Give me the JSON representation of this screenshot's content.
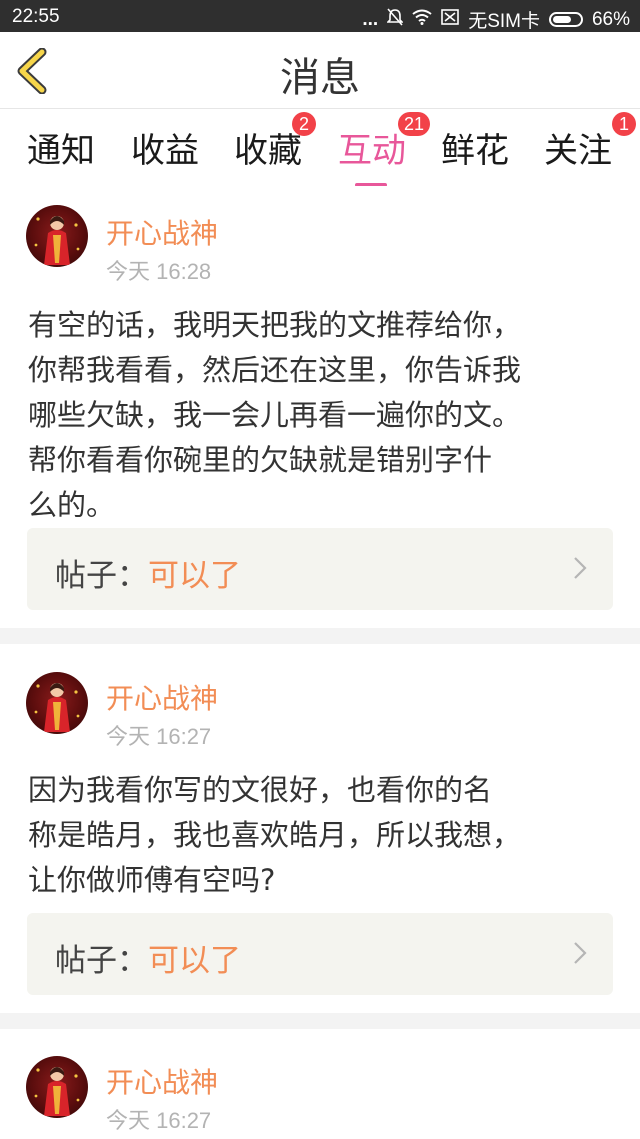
{
  "status_bar": {
    "time": "22:55",
    "dots": "...",
    "sim": "无SIM卡",
    "battery": "66%"
  },
  "header": {
    "title": "消息"
  },
  "tabs": [
    {
      "label": "通知",
      "badge": ""
    },
    {
      "label": "收益",
      "badge": ""
    },
    {
      "label": "收藏",
      "badge": "2"
    },
    {
      "label": "互动",
      "badge": "21",
      "active": true
    },
    {
      "label": "鲜花",
      "badge": ""
    },
    {
      "label": "关注",
      "badge": "1"
    }
  ],
  "colors": {
    "accent": "#e8579a",
    "name": "#f28d55",
    "badge": "#f24148"
  },
  "messages": [
    {
      "user": "开心战神",
      "time": "今天 16:28",
      "lines": [
        "有空的话，我明天把我的文推荐给你，",
        "你帮我看看，然后还在这里，你告诉我",
        "哪些欠缺，我一会儿再看一遍你的文。",
        "帮你看看你碗里的欠缺就是错别字什",
        "么的。"
      ],
      "post_label": "帖子：",
      "post_title": "可以了"
    },
    {
      "user": "开心战神",
      "time": "今天 16:27",
      "lines": [
        "因为我看你写的文很好，也看你的名",
        "称是皓月，我也喜欢皓月，所以我想，",
        "让你做师傅有空吗?"
      ],
      "post_label": "帖子：",
      "post_title": "可以了"
    },
    {
      "user": "开心战神",
      "time": "今天 16:27"
    }
  ]
}
